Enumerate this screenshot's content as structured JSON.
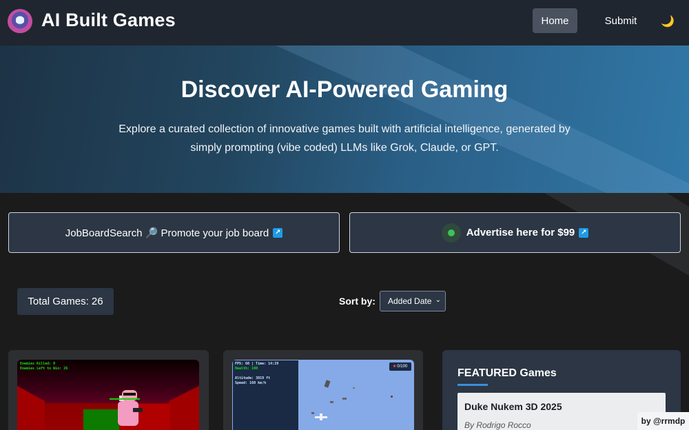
{
  "header": {
    "brand": "AI Built Games",
    "nav": {
      "home": "Home",
      "submit": "Submit"
    },
    "theme_icon": "moon-icon"
  },
  "hero": {
    "title": "Discover AI-Powered Gaming",
    "description": "Explore a curated collection of innovative games built with artificial intelligence, generated by simply prompting (vibe coded) LLMs like Grok, Claude, or GPT."
  },
  "promos": [
    {
      "text": "JobBoardSearch 🔎 Promote your job board",
      "icon": "external-link-icon"
    },
    {
      "text": "Advertise here for $99",
      "icon": "external-link-icon",
      "status_color": "#3ec15a"
    }
  ],
  "controls": {
    "total_games": "Total Games: 26",
    "sort_label": "Sort by:",
    "sort_selected": "Added Date"
  },
  "games": [
    {
      "hud": [
        "Enemies Killed: 0",
        "Enemies Left to Win: 26"
      ]
    },
    {
      "hud": [
        "FPS: 60 | Time: 14:29",
        "Health: 100",
        "Altitude: 3019 ft",
        "Speed: 160 km/h"
      ],
      "counter": "0/100"
    }
  ],
  "featured": {
    "title": "FEATURED Games",
    "items": [
      {
        "name": "Duke Nukem 3D 2025",
        "author": "By Rodrigo Rocco"
      }
    ]
  },
  "byline": "by @rrmdp",
  "colors": {
    "accent": "#3b8fd8",
    "hero": "#2a5f86",
    "panel": "#2c3644"
  }
}
